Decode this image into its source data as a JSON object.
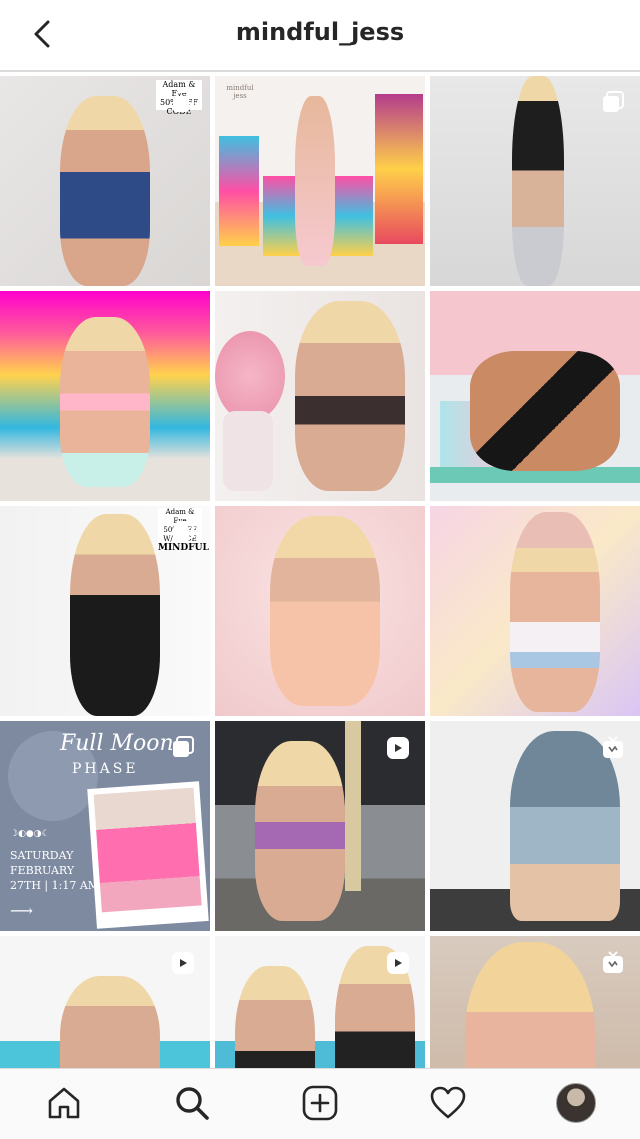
{
  "header": {
    "title": "mindful_jess"
  },
  "posts": [
    {
      "name": "post-1",
      "badge": "carousel",
      "overlay": [
        "Adam & Eve",
        "50% OFF",
        "CODE"
      ]
    },
    {
      "name": "post-2",
      "badge": "",
      "overlay": [
        "mindful",
        "jess"
      ]
    },
    {
      "name": "post-3",
      "badge": "carousel",
      "overlay": []
    },
    {
      "name": "post-4",
      "badge": "",
      "overlay": []
    },
    {
      "name": "post-5",
      "badge": "",
      "overlay": []
    },
    {
      "name": "post-6",
      "badge": "",
      "overlay": []
    },
    {
      "name": "post-7",
      "badge": "carousel",
      "overlay": [
        "Adam & Eve",
        "50% OFF W/ CODE",
        "MINDFUL"
      ]
    },
    {
      "name": "post-8",
      "badge": "",
      "overlay": []
    },
    {
      "name": "post-9",
      "badge": "",
      "overlay": []
    },
    {
      "name": "post-10",
      "badge": "carousel",
      "overlay": [
        "Full Moon",
        "PHASE",
        "SATURDAY",
        "FEBRUARY",
        "27TH | 1:17 AM"
      ]
    },
    {
      "name": "post-11",
      "badge": "reel",
      "overlay": []
    },
    {
      "name": "post-12",
      "badge": "igtv",
      "overlay": []
    },
    {
      "name": "post-13",
      "badge": "reel",
      "overlay": []
    },
    {
      "name": "post-14",
      "badge": "reel",
      "overlay": []
    },
    {
      "name": "post-15",
      "badge": "igtv",
      "overlay": []
    }
  ],
  "bottom_nav": [
    {
      "name": "home-icon"
    },
    {
      "name": "search-icon"
    },
    {
      "name": "new-post-icon"
    },
    {
      "name": "activity-heart-icon"
    },
    {
      "name": "profile-avatar"
    }
  ]
}
